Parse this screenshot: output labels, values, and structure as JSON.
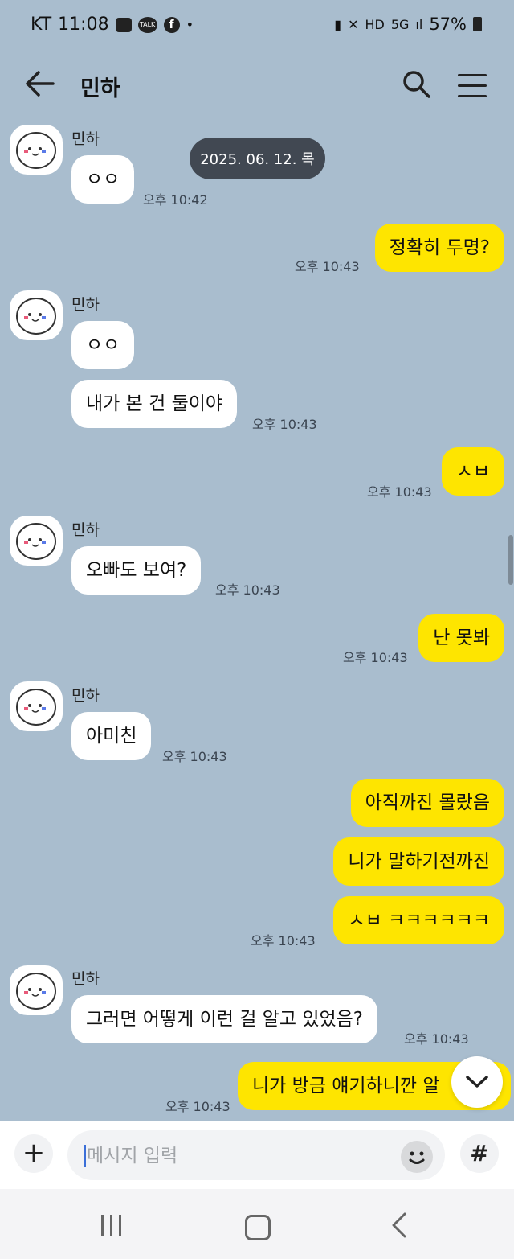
{
  "status_bar": {
    "carrier": "KT",
    "time": "11:08",
    "battery": "57%",
    "left_icons": [
      "gallery-icon",
      "kakaotalk-notification-icon",
      "facebook-icon",
      "dot-icon"
    ],
    "right_icons": [
      "nfc-icon",
      "mute-icon",
      "hd-voice-icon",
      "5g-icon",
      "signal-icon",
      "battery-icon"
    ]
  },
  "header": {
    "title": "민하",
    "talk_badge": "TALK",
    "fb_badge": "f",
    "icons": [
      "back-arrow-icon",
      "search-icon",
      "menu-icon"
    ]
  },
  "date_pill": "2025. 06. 12. 목",
  "messages": {
    "sender_name": "민하",
    "g1_b1": "ㅇㅇ",
    "g1_time": "오후 10:42",
    "o1_b1": "정확히 두명?",
    "o1_time": "오후 10:43",
    "g2_b1": "ㅇㅇ",
    "g2_b2": "내가 본 건 둘이야",
    "g2_time": "오후 10:43",
    "o2_b1": "ㅅㅂ",
    "o2_time": "오후 10:43",
    "g3_b1": "오빠도 보여?",
    "g3_time": "오후 10:43",
    "o3_b1": "난 못봐",
    "o3_time": "오후 10:43",
    "g4_b1": "아미친",
    "g4_time": "오후 10:43",
    "o4_b1": "아직까진 몰랐음",
    "o4_b2": "니가 말하기전까진",
    "o4_b3": "ㅅㅂ ㅋㅋㅋㅋㅋㅋ",
    "o4_time": "오후 10:43",
    "g5_b1": "그러면 어떻게 이런 걸 알고 있었음?",
    "g5_time": "오후 10:43",
    "o5_b1": "니가 방금 얘기하니깐 알",
    "o5_time": "오후 10:43"
  },
  "input_bar": {
    "placeholder": "메시지 입력",
    "plus": "+",
    "hash": "#"
  },
  "colors": {
    "background": "#a9bdce",
    "outgoing_bubble": "#fee500",
    "incoming_bubble": "#ffffff",
    "date_pill": "#414852"
  }
}
